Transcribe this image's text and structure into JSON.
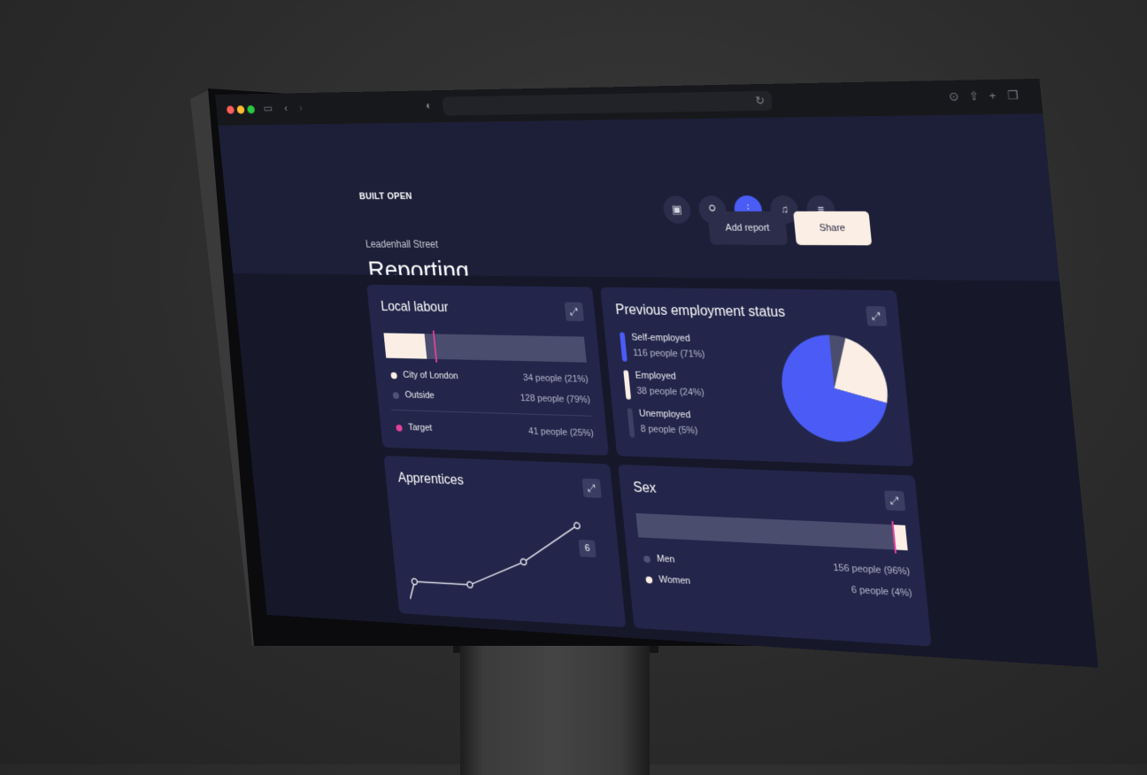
{
  "app": {
    "brand": "BUILT OPEN",
    "breadcrumb": "Leadenhall Street",
    "title": "Reporting",
    "add_report_label": "Add report",
    "share_label": "Share",
    "nav_icons": [
      "briefcase-icon",
      "search-icon",
      "chart-icon",
      "bell-icon",
      "menu-icon"
    ],
    "accent_color": "#4a5cf5",
    "marker_color": "#e5419a"
  },
  "cards": {
    "local_labour": {
      "title": "Local labour",
      "bar_fill_fraction": 0.21,
      "target_fraction": 0.25,
      "rows": [
        {
          "label": "City of London",
          "value": "34 people (21%)"
        },
        {
          "label": "Outside",
          "value": "128 people (79%)"
        }
      ],
      "target": {
        "label": "Target",
        "value": "41 people (25%)"
      }
    },
    "employment": {
      "title": "Previous employment status",
      "rows": [
        {
          "label": "Self-employed",
          "value": "116 people (71%)",
          "percent": 71,
          "color": "#4a5cf5"
        },
        {
          "label": "Employed",
          "value": "38 people (24%)",
          "percent": 24,
          "color": "#fbeee5"
        },
        {
          "label": "Unemployed",
          "value": "8 people (5%)",
          "percent": 5,
          "color": "#3e4166"
        }
      ]
    },
    "apprentices": {
      "title": "Apprentices",
      "last_value": "6",
      "points": [
        1,
        1,
        3,
        6
      ]
    },
    "sex": {
      "title": "Sex",
      "bar_fill_fraction": 0.04,
      "rows": [
        {
          "label": "Men",
          "value": "156 people (96%)"
        },
        {
          "label": "Women",
          "value": "6 people (4%)"
        }
      ]
    }
  }
}
